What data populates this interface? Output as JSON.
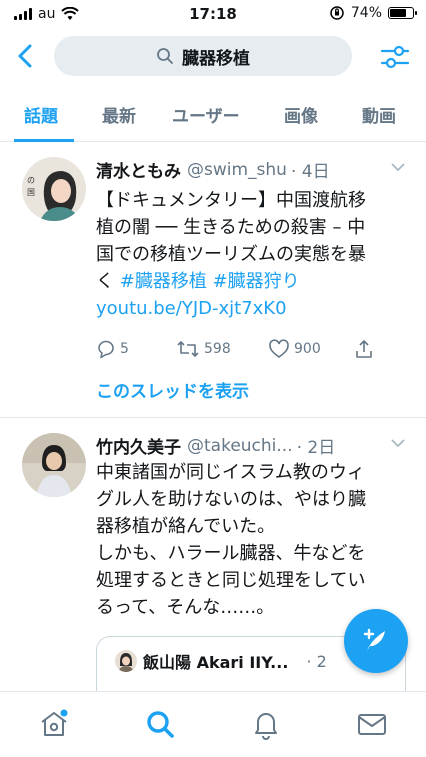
{
  "status_bar": {
    "carrier": "au",
    "time": "17:18",
    "battery_text": "74%",
    "battery_level": 0.74
  },
  "header": {
    "search_query": "臓器移植",
    "icons": {
      "back": "chevron-left-icon",
      "search": "search-icon",
      "filter": "sliders-icon"
    }
  },
  "tabs": [
    {
      "label": "話題",
      "active": true
    },
    {
      "label": "最新",
      "active": false
    },
    {
      "label": "ユーザー",
      "active": false
    },
    {
      "label": "画像",
      "active": false
    },
    {
      "label": "動画",
      "active": false
    }
  ],
  "tweets": [
    {
      "name": "清水ともみ",
      "handle": "@swim_shu",
      "time": "· 4日",
      "text_lines": [
        "【ドキュメンタリー】中国渡航移",
        "植の闇 ── 生きるための殺害 – 中",
        "国での移植ツーリズムの実態を暴"
      ],
      "text_tail": "く ",
      "hashtags": [
        "#臓器移植",
        "#臓器狩り"
      ],
      "link": "youtu.be/YJD-xjt7xK0",
      "replies": "5",
      "retweets": "598",
      "likes": "900",
      "show_thread": "このスレッドを表示"
    },
    {
      "name": "竹内久美子",
      "handle": "@takeuchi...",
      "time": "· 2日",
      "text_lines": [
        "中東諸国が同じイスラム教のウィ",
        "グル人を助けないのは、やはり臓",
        "器移植が絡んでいた。",
        "しかも、ハラール臓器、牛などを",
        "処理するときと同じ処理をしてい",
        "るって、そんな……。"
      ],
      "quote": {
        "name": "飯山陽 Akari IIY...",
        "time": "· 2"
      }
    }
  ],
  "bottom_nav": [
    {
      "icon": "home-icon",
      "active": false,
      "has_dot": true
    },
    {
      "icon": "search-icon",
      "active": true,
      "has_dot": false
    },
    {
      "icon": "bell-icon",
      "active": false,
      "has_dot": false
    },
    {
      "icon": "mail-icon",
      "active": false,
      "has_dot": false
    }
  ],
  "fab": {
    "icon": "compose-feather-icon"
  },
  "colors": {
    "accent": "#1da1f2",
    "muted": "#657786",
    "text": "#14171a",
    "divider": "#e1e8ed",
    "search_bg": "#e6ecf0"
  }
}
